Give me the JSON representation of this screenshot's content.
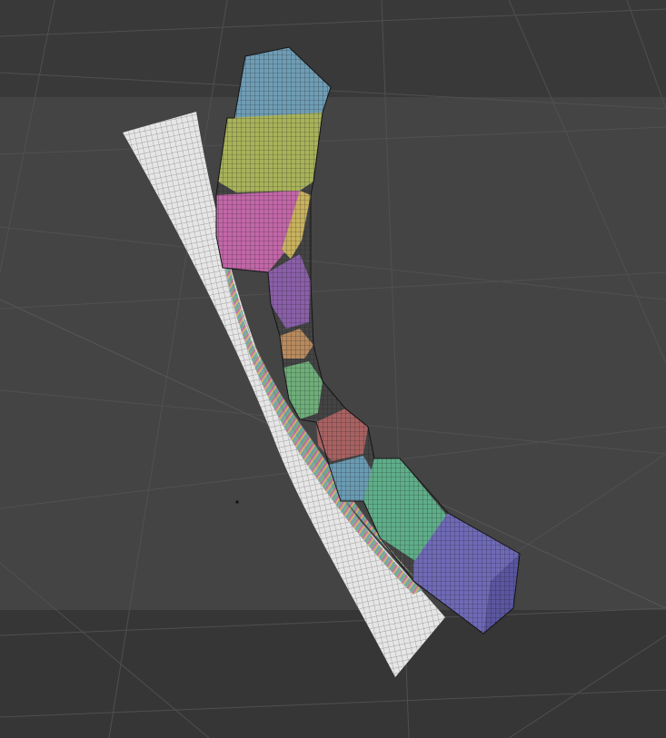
{
  "viewport": {
    "label": "",
    "background_colors": {
      "top_band": "#393939",
      "middle_band": "#444444",
      "bottom_band": "#363636",
      "grid_line": "#525252"
    }
  },
  "objects": {
    "cloth_plane": {
      "color": "#e6e6e6",
      "wire_color": "#8a8a8a"
    },
    "curved_beam": {
      "wire_color": "#1a1a1a",
      "cell_colors": [
        "#6f9db5",
        "#a8b35a",
        "#c267a8",
        "#c9b25e",
        "#8a5fa8",
        "#b88a5e",
        "#6fae7a",
        "#a86262",
        "#6a9bb3",
        "#5fae8a",
        "#6f6ab6"
      ]
    }
  }
}
